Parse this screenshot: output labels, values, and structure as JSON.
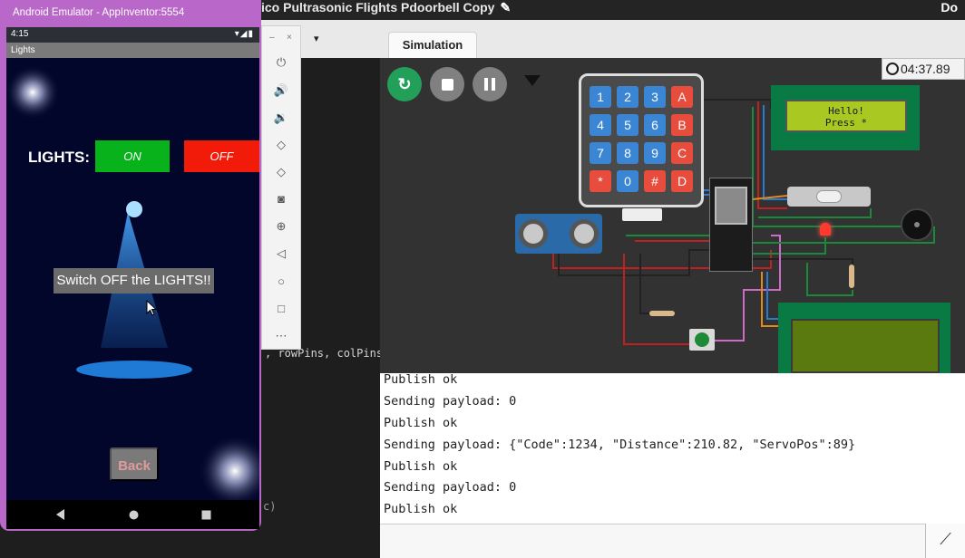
{
  "ide": {
    "title_fragment": "ico Pultrasonic Flights Pdoorbell Copy",
    "corner_text": "Do",
    "editor_dropdown": "▾",
    "sim_tab_label": "Simulation",
    "code_line_1": ", rowPins, colPins",
    "code_line_2": "c)"
  },
  "simulation": {
    "timer": "04:37.89",
    "keypad_keys": [
      "1",
      "2",
      "3",
      "A",
      "4",
      "5",
      "6",
      "B",
      "7",
      "8",
      "9",
      "C",
      "*",
      "0",
      "#",
      "D"
    ],
    "lcd1_line1": "Hello!",
    "lcd1_line2": "Press *"
  },
  "serial": {
    "lines": [
      "Publish ok",
      "Sending payload: 0",
      "Publish ok",
      "Sending payload: {\"Code\":1234, \"Distance\":210.82, \"ServoPos\":89}",
      "Publish ok",
      "Sending payload: 0",
      "Publish ok"
    ]
  },
  "emulator": {
    "window_title": "Android Emulator - AppInventor:5554",
    "status_time": "4:15",
    "status_icons": "▾◢▮",
    "app_title": "Lights",
    "lights_label": "LIGHTS:",
    "on_label": "ON",
    "off_label": "OFF",
    "message": "Switch OFF the LIGHTS!!",
    "back_label": "Back",
    "toolbar_min": "–",
    "toolbar_close": "×"
  },
  "colors": {
    "on": "#08b21a",
    "off": "#f21a08",
    "emulator_frame": "#b967c9",
    "phone_bg": "#02062a"
  }
}
